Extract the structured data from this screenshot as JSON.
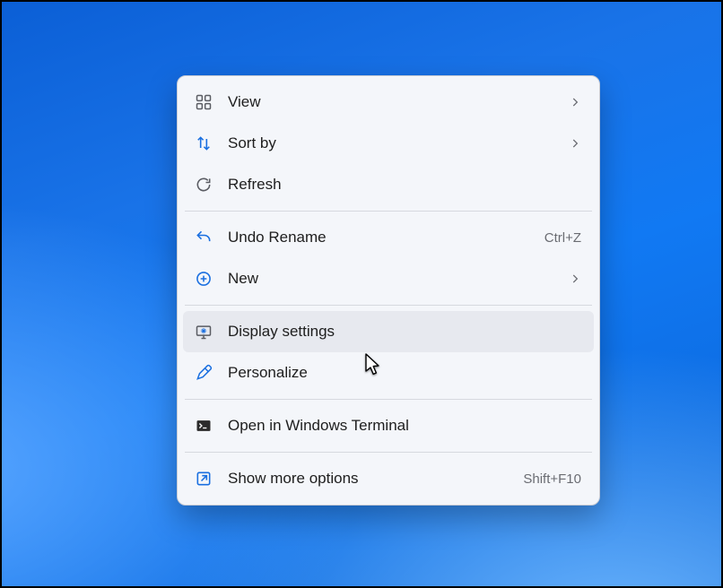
{
  "menu": {
    "groups": [
      [
        {
          "id": "view",
          "icon": "grid",
          "label": "View",
          "submenu": true
        },
        {
          "id": "sort",
          "icon": "sort",
          "label": "Sort by",
          "submenu": true
        },
        {
          "id": "refresh",
          "icon": "refresh",
          "label": "Refresh"
        }
      ],
      [
        {
          "id": "undo",
          "icon": "undo",
          "label": "Undo Rename",
          "accel": "Ctrl+Z"
        },
        {
          "id": "new",
          "icon": "new",
          "label": "New",
          "submenu": true
        }
      ],
      [
        {
          "id": "display",
          "icon": "display",
          "label": "Display settings",
          "hover": true
        },
        {
          "id": "personalize",
          "icon": "pen",
          "label": "Personalize"
        }
      ],
      [
        {
          "id": "terminal",
          "icon": "terminal",
          "label": "Open in Windows Terminal"
        }
      ],
      [
        {
          "id": "more",
          "icon": "expand",
          "label": "Show more options",
          "accel": "Shift+F10"
        }
      ]
    ]
  }
}
